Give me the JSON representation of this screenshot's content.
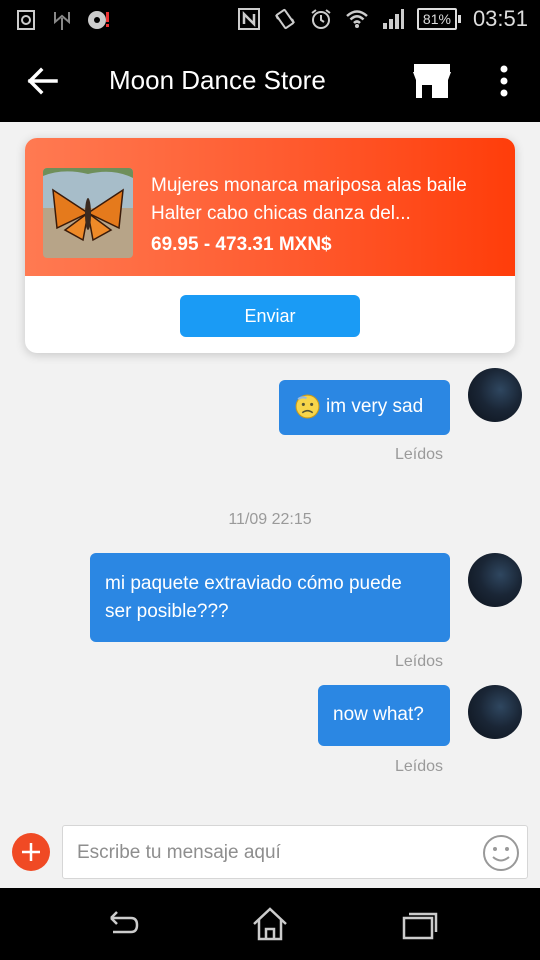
{
  "status_bar": {
    "battery": "81%",
    "time": "03:51",
    "icons": [
      "screenshot-icon",
      "usb-icon",
      "disc-alert-icon",
      "nfc-icon",
      "vibrate-icon",
      "alarm-icon",
      "wifi-icon",
      "signal-icon",
      "battery-icon"
    ]
  },
  "header": {
    "title": "Moon Dance Store",
    "icons": [
      "back-arrow-icon",
      "store-icon",
      "more-vertical-icon"
    ]
  },
  "product_card": {
    "name": "Mujeres monarca mariposa alas baile Halter cabo chicas danza del...",
    "price": "69.95 - 473.31 MXN$",
    "send_label": "Enviar",
    "accent_gradient": [
      "#ff7a52",
      "#ff3d0a"
    ]
  },
  "messages": [
    {
      "text": "im very sad",
      "emoji": "sad-face-emoji-icon",
      "status": "Leídos"
    },
    {
      "timestamp": "11/09 22:15"
    },
    {
      "text": "mi paquete extraviado cómo puede ser posible???",
      "status": "Leídos"
    },
    {
      "text": "now what?",
      "status": "Leídos"
    }
  ],
  "input": {
    "placeholder": "Escribe tu mensaje aquí"
  },
  "colors": {
    "bubble": "#2b87e3",
    "send_button": "#1a9bf5",
    "plus_button": "#f04a24"
  },
  "nav_bar": {
    "icons": [
      "back-nav-icon",
      "home-nav-icon",
      "recents-nav-icon"
    ]
  }
}
